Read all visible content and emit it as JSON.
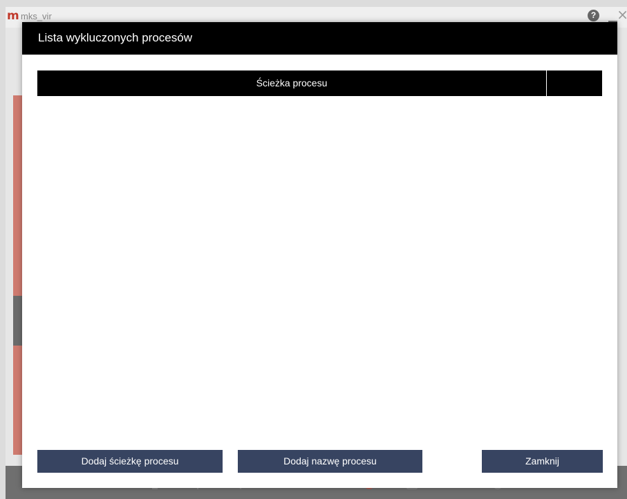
{
  "app": {
    "logo": "m",
    "title": "mks_vir",
    "help_glyph": "?",
    "close_glyph": "×"
  },
  "dialog": {
    "title": "Lista wykluczonych procesów",
    "table": {
      "columns": [
        "Ścieżka procesu",
        ""
      ],
      "rows": []
    },
    "buttons": {
      "add_path": "Dodaj ścieżkę procesu",
      "add_name": "Dodaj nazwę procesu",
      "close": "Zamknij"
    }
  },
  "colors": {
    "header_bg": "#000000",
    "button_bg": "#374461",
    "button_text": "#ffffff",
    "accent_red": "#c0392b"
  }
}
